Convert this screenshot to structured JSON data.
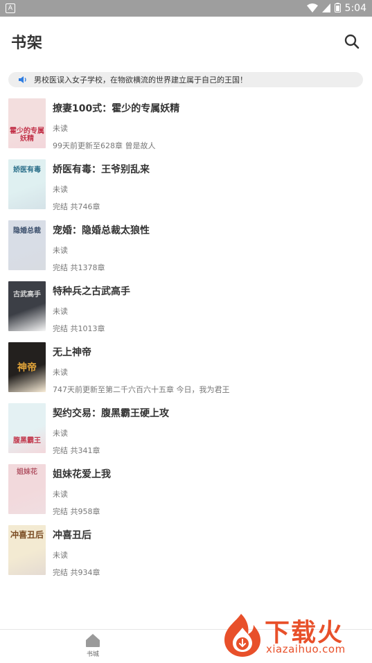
{
  "status_bar": {
    "time": "5:04",
    "app_badge": "A"
  },
  "header": {
    "title": "书架"
  },
  "notice": {
    "text": "男校医误入女子学校，在物欲横流的世界建立属于自己的王国！"
  },
  "books": [
    {
      "title": "撩妻100式：霍少的专属妖精",
      "status": "未读",
      "progress": "99天前更新至628章 曾是故人",
      "cover_text": "霍少的专属妖精",
      "cover_bg": "#f3dede",
      "cover_accent": "#c2334a"
    },
    {
      "title": "娇医有毒：王爷别乱来",
      "status": "未读",
      "progress": "完结 共746章",
      "cover_text": "娇医有毒",
      "cover_bg": "#dff0f1",
      "cover_accent": "#2b6f8a"
    },
    {
      "title": "宠婚：隐婚总裁太狼性",
      "status": "未读",
      "progress": "完结 共1378章",
      "cover_text": "隐婚总裁",
      "cover_bg": "#d8dde6",
      "cover_accent": "#3a4e6b"
    },
    {
      "title": "特种兵之古武高手",
      "status": "未读",
      "progress": "完结 共1013章",
      "cover_text": "古武高手",
      "cover_bg": "#3c3f46",
      "cover_accent": "#d8d8d8"
    },
    {
      "title": "无上神帝",
      "status": "未读",
      "progress": "747天前更新至第二千六百六十五章 今日，我为君王",
      "cover_text": "神帝",
      "cover_bg": "#23201e",
      "cover_accent": "#e3a53a"
    },
    {
      "title": "契约交易：腹黑霸王硬上攻",
      "status": "未读",
      "progress": "完结 共341章",
      "cover_text": "腹黑霸王",
      "cover_bg": "#e4f1f3",
      "cover_accent": "#c23a4e"
    },
    {
      "title": "姐妹花爱上我",
      "status": "未读",
      "progress": "完结 共958章",
      "cover_text": "姐妹花",
      "cover_bg": "#f2d9dc",
      "cover_accent": "#b45a6a"
    },
    {
      "title": "冲喜丑后",
      "status": "未读",
      "progress": "完结 共934章",
      "cover_text": "冲喜丑后",
      "cover_bg": "#f3ead2",
      "cover_accent": "#7a4b22"
    }
  ],
  "bottom_nav": {
    "items": [
      {
        "label": "书城",
        "icon": "home-icon"
      }
    ]
  },
  "watermark": {
    "name": "下载火",
    "url": "xiazaihuo.com"
  },
  "colors": {
    "status_bar": "#9e9e9e",
    "notice_bg": "#eeeeee",
    "notice_icon": "#2f7de1",
    "watermark": "#e8502a"
  }
}
